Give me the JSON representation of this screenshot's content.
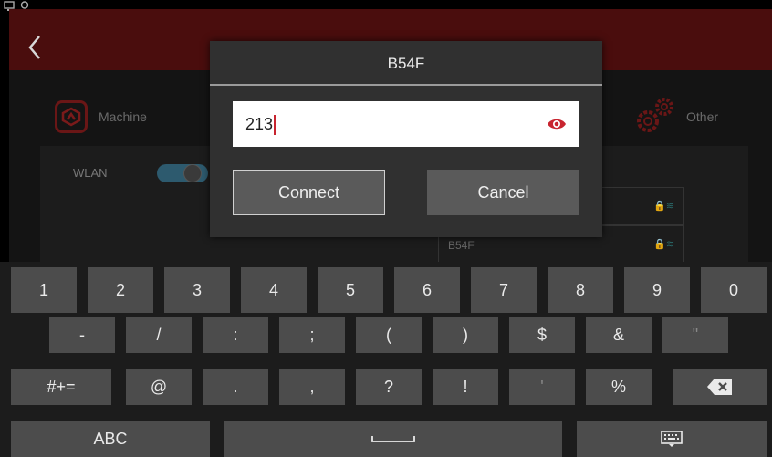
{
  "status_icons": [
    "monitor-icon",
    "webcam-icon"
  ],
  "background": {
    "categories": [
      {
        "label": "Machine",
        "icon": "machine-icon"
      },
      {
        "label": "Other",
        "icon": "gears-icon"
      }
    ],
    "wlan_label": "WLAN",
    "networks": [
      {
        "name": ""
      },
      {
        "name": "B54F"
      }
    ]
  },
  "dialog": {
    "title": "B54F",
    "password_value": "213",
    "connect_label": "Connect",
    "cancel_label": "Cancel"
  },
  "keyboard": {
    "row1": [
      "1",
      "2",
      "3",
      "4",
      "5",
      "6",
      "7",
      "8",
      "9",
      "0"
    ],
    "row2": [
      "-",
      "/",
      ":",
      ";",
      "(",
      ")",
      "$",
      "&",
      "\""
    ],
    "row3": [
      "#+=",
      "@",
      ".",
      ",",
      "?",
      "!",
      "'",
      "%"
    ],
    "abc_label": "ABC"
  },
  "colors": {
    "accent": "#c8242f",
    "header": "#4a0d0d",
    "key": "#4c4c4c"
  }
}
